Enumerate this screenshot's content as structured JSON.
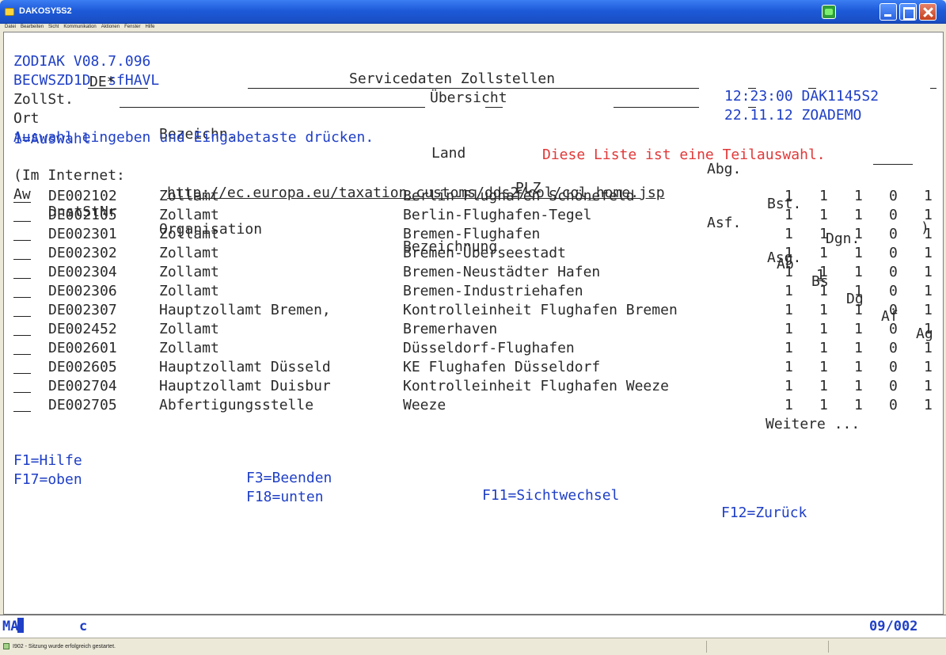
{
  "window": {
    "title": "DAKOSY5S2",
    "status_message": "I902 - Sitzung wurde erfolgreich gestartet."
  },
  "menu": [
    "Datei",
    "Bearbeiten",
    "Sicht",
    "Kommunikation",
    "Aktionen",
    "Fenster",
    "Hilfe"
  ],
  "header": {
    "program": "ZODIAK V08.7.096",
    "title": "Servicedaten Zollstellen",
    "time_session": "12:23:00 DAK1145S2",
    "screen_id": "BECWSZD1D  sfHAVL",
    "subtitle": "Übersicht",
    "date_user": "22.11.12 ZOADEMO"
  },
  "filters": {
    "zollst_label": "ZollSt.",
    "zollst_value": "DE*",
    "bezeichn_label": "Bezeichn.",
    "abg_label": "Abg.",
    "bst_label": "Bst.",
    "dgn_label": "Dgn.",
    "ort_label": "Ort",
    "land_label": "Land",
    "plz_label": "PLZ",
    "asf_label": "Asf.",
    "asg_label": "Asg.",
    "asg_value": "1"
  },
  "messages": {
    "instruction": "Auswahl eingeben und Eingabetaste drücken.",
    "partial_notice": "Diese Liste ist eine Teilauswahl.",
    "legend": "1=Auswahl",
    "internet_prefix": "(Im Internet:",
    "internet_url": "http://ec.europa.eu/taxation_customs/dds2/col/col_home.jsp",
    "internet_suffix": ")"
  },
  "table": {
    "headers": {
      "aw": "Aw",
      "dnst": "DnstStNr",
      "org": "Organisation",
      "bez": "Bezeichnung",
      "ab": "Ab",
      "bs": "Bs",
      "dg": "Dg",
      "af": "Af",
      "ag": "Ag"
    },
    "rows": [
      {
        "dnst": "DE002102",
        "org": "Zollamt",
        "bez": "Berlin-Flughafen Schönefeld",
        "ab": "1",
        "bs": "1",
        "dg": "1",
        "af": "0",
        "ag": "1"
      },
      {
        "dnst": "DE002105",
        "org": "Zollamt",
        "bez": "Berlin-Flughafen-Tegel",
        "ab": "1",
        "bs": "1",
        "dg": "1",
        "af": "0",
        "ag": "1"
      },
      {
        "dnst": "DE002301",
        "org": "Zollamt",
        "bez": "Bremen-Flughafen",
        "ab": "1",
        "bs": "1",
        "dg": "1",
        "af": "0",
        "ag": "1"
      },
      {
        "dnst": "DE002302",
        "org": "Zollamt",
        "bez": "Bremen-Überseestadt",
        "ab": "1",
        "bs": "1",
        "dg": "1",
        "af": "0",
        "ag": "1"
      },
      {
        "dnst": "DE002304",
        "org": "Zollamt",
        "bez": "Bremen-Neustädter Hafen",
        "ab": "1",
        "bs": "1",
        "dg": "1",
        "af": "0",
        "ag": "1"
      },
      {
        "dnst": "DE002306",
        "org": "Zollamt",
        "bez": "Bremen-Industriehafen",
        "ab": "1",
        "bs": "1",
        "dg": "1",
        "af": "0",
        "ag": "1"
      },
      {
        "dnst": "DE002307",
        "org": "Hauptzollamt Bremen,",
        "bez": "Kontrolleinheit Flughafen Bremen",
        "ab": "1",
        "bs": "1",
        "dg": "1",
        "af": "0",
        "ag": "1"
      },
      {
        "dnst": "DE002452",
        "org": "Zollamt",
        "bez": "Bremerhaven",
        "ab": "1",
        "bs": "1",
        "dg": "1",
        "af": "0",
        "ag": "1"
      },
      {
        "dnst": "DE002601",
        "org": "Zollamt",
        "bez": "Düsseldorf-Flughafen",
        "ab": "1",
        "bs": "1",
        "dg": "1",
        "af": "0",
        "ag": "1"
      },
      {
        "dnst": "DE002605",
        "org": "Hauptzollamt Düsseld",
        "bez": "KE Flughafen Düsseldorf",
        "ab": "1",
        "bs": "1",
        "dg": "1",
        "af": "0",
        "ag": "1"
      },
      {
        "dnst": "DE002704",
        "org": "Hauptzollamt Duisbur",
        "bez": "Kontrolleinheit Flughafen Weeze",
        "ab": "1",
        "bs": "1",
        "dg": "1",
        "af": "0",
        "ag": "1"
      },
      {
        "dnst": "DE002705",
        "org": "Abfertigungsstelle",
        "bez": "Weeze",
        "ab": "1",
        "bs": "1",
        "dg": "1",
        "af": "0",
        "ag": "1"
      }
    ],
    "more": "Weitere ..."
  },
  "function_keys": {
    "f1": "F1=Hilfe",
    "f3": "F3=Beenden",
    "f11": "F11=Sichtwechsel",
    "f12": "F12=Zurück",
    "f17": "F17=oben",
    "f18": "F18=unten"
  },
  "oia": {
    "mode": "MA",
    "indicator": "c",
    "cursor_pos": "09/002"
  }
}
